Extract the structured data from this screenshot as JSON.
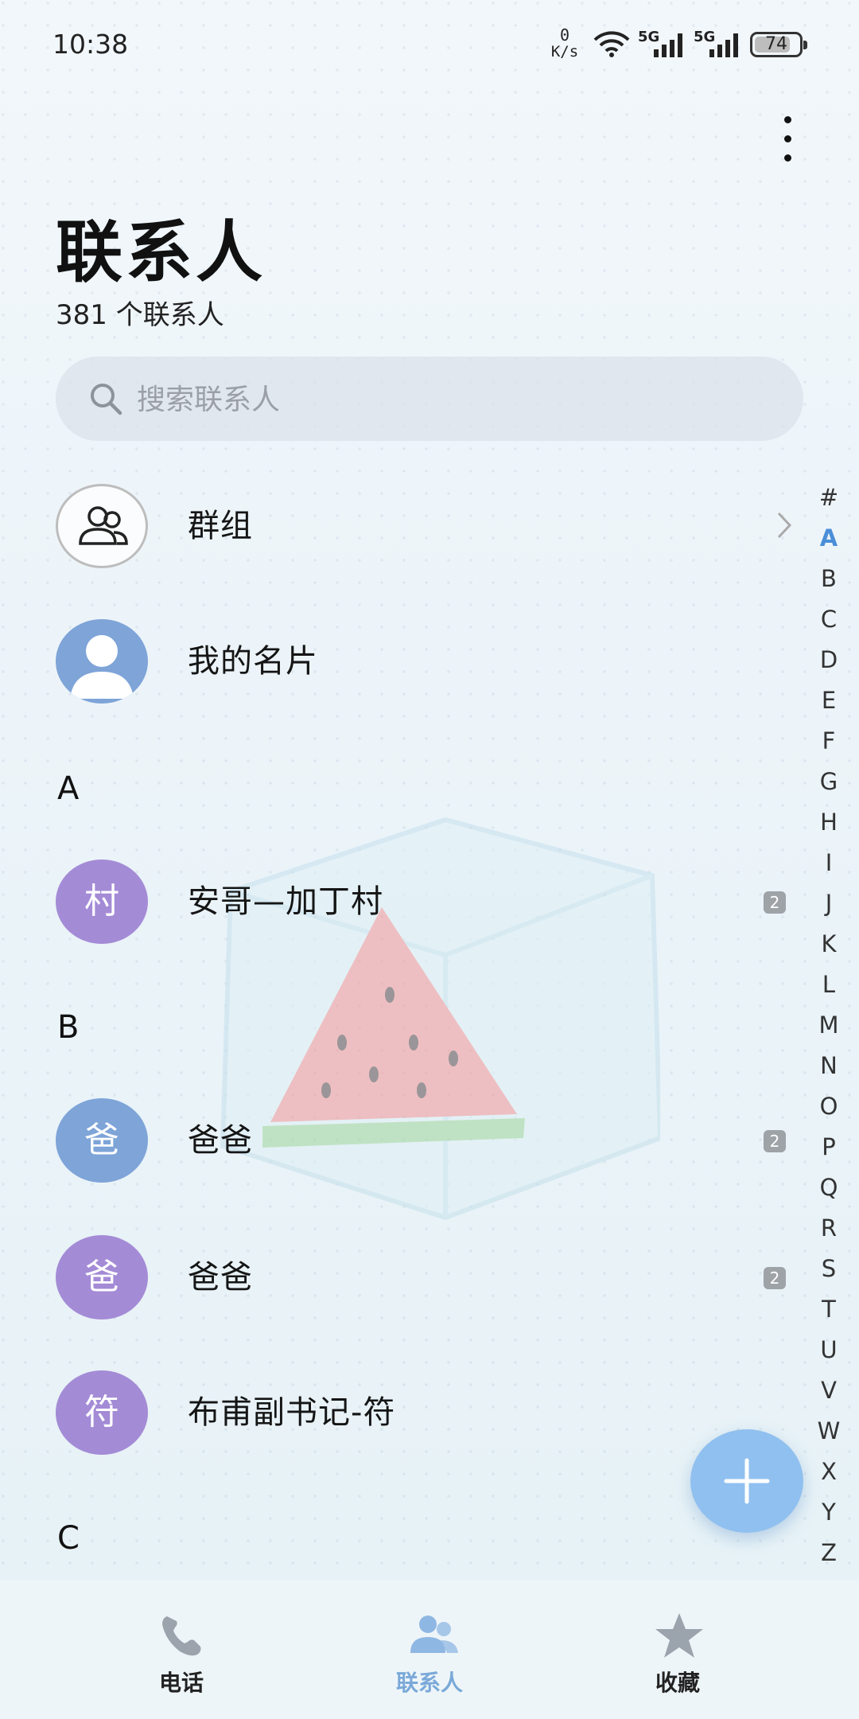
{
  "status_bar": {
    "time": "10:38",
    "net_speed_value": "0",
    "net_speed_unit": "K/s",
    "sim1_label": "5G",
    "sim2_label": "5G",
    "battery": "74"
  },
  "header": {
    "title": "联系人",
    "count": "381 个联系人"
  },
  "search": {
    "placeholder": "搜索联系人"
  },
  "special_rows": {
    "groups_label": "群组",
    "my_card_label": "我的名片"
  },
  "sections": [
    {
      "letter": "A",
      "contacts": [
        {
          "avatar": "村",
          "name": "安哥—加丁村",
          "badge": "2",
          "color": "#a48bd6"
        }
      ]
    },
    {
      "letter": "B",
      "contacts": [
        {
          "avatar": "爸",
          "name": "爸爸",
          "badge": "2",
          "color": "#7ea4d8"
        },
        {
          "avatar": "爸",
          "name": "爸爸",
          "badge": "2",
          "color": "#a48bd6"
        },
        {
          "avatar": "符",
          "name": "布甫副书记-符",
          "color": "#a48bd6"
        }
      ]
    },
    {
      "letter": "C"
    }
  ],
  "alpha_index": [
    "#",
    "A",
    "B",
    "C",
    "D",
    "E",
    "F",
    "G",
    "H",
    "I",
    "J",
    "K",
    "L",
    "M",
    "N",
    "O",
    "P",
    "Q",
    "R",
    "S",
    "T",
    "U",
    "V",
    "W",
    "X",
    "Y",
    "Z"
  ],
  "alpha_active": "A",
  "bottom_nav": [
    {
      "label": "电话",
      "icon": "phone-icon"
    },
    {
      "label": "联系人",
      "icon": "contacts-icon",
      "active": true
    },
    {
      "label": "收藏",
      "icon": "star-icon"
    }
  ],
  "colors": {
    "accent": "#7aa9d8",
    "fab": "#90c0ef",
    "avatar_purple": "#a48bd6",
    "avatar_blue": "#7ea4d8"
  }
}
